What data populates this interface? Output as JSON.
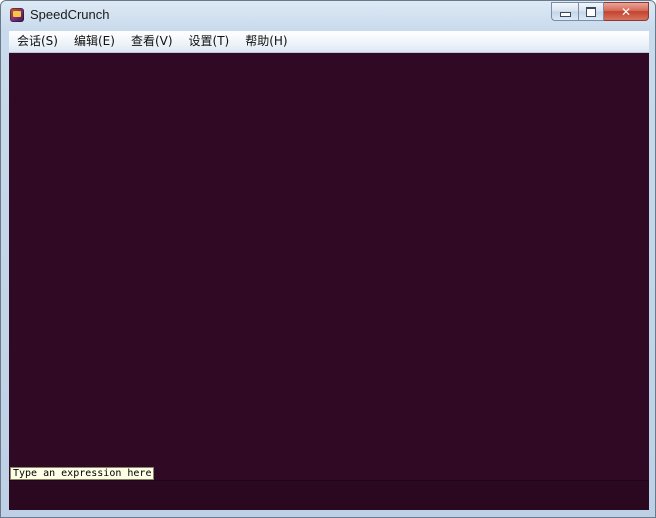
{
  "window": {
    "title": "SpeedCrunch",
    "icon": "speedcrunch-app-icon",
    "close_glyph": "✕"
  },
  "menubar": {
    "items": [
      {
        "label": "会话(S)"
      },
      {
        "label": "编辑(E)"
      },
      {
        "label": "查看(V)"
      },
      {
        "label": "设置(T)"
      },
      {
        "label": "帮助(H)"
      }
    ]
  },
  "content": {
    "background": "#300a24",
    "hint_text": "Type an expression here",
    "editor_value": ""
  }
}
